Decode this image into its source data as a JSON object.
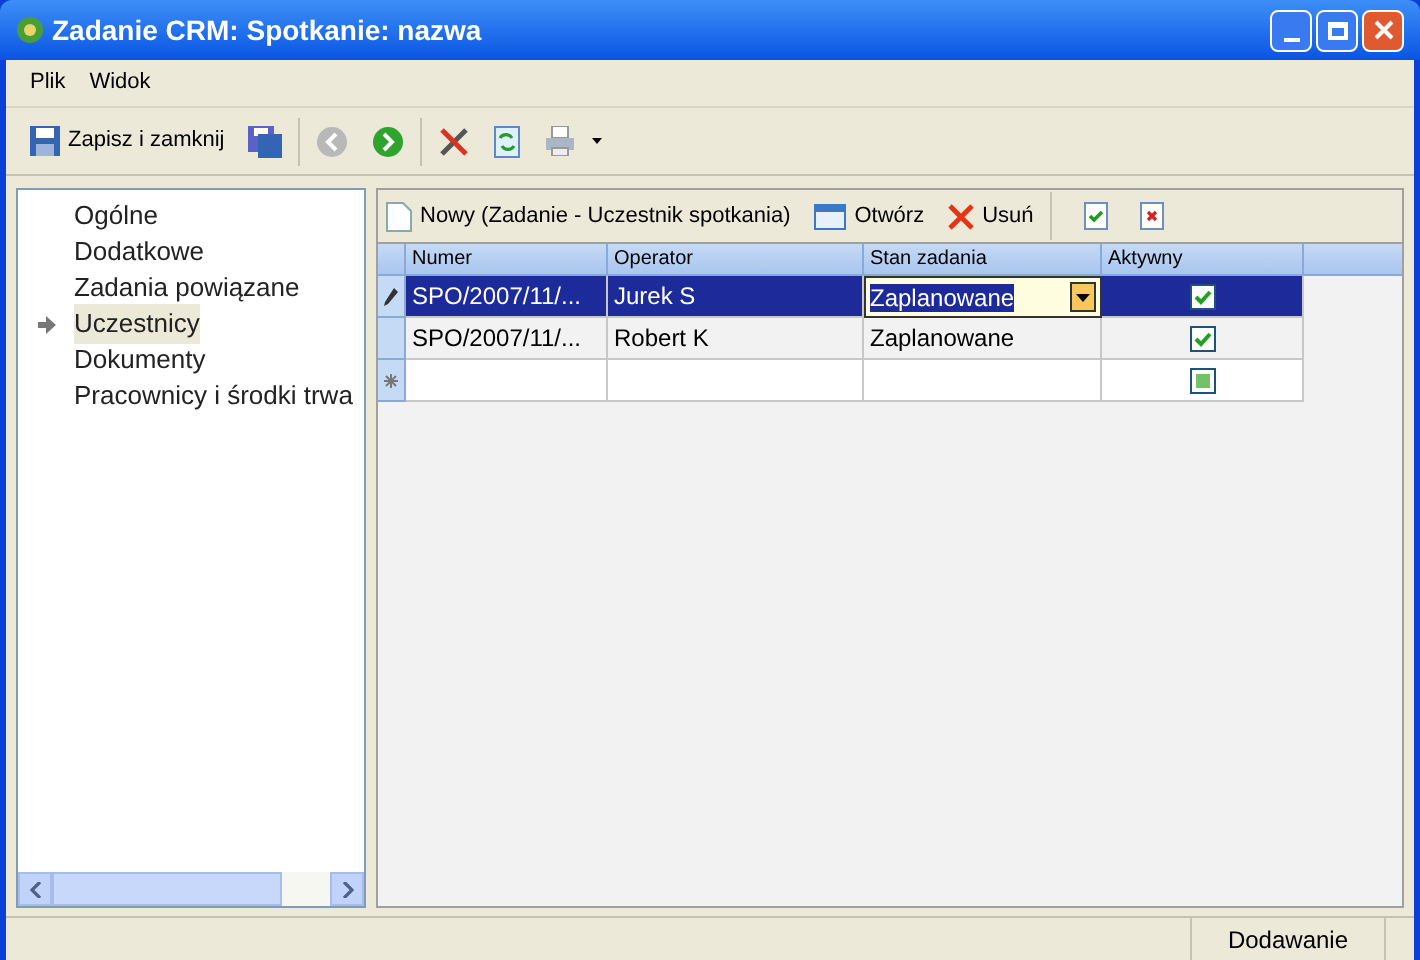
{
  "window": {
    "title": "Zadanie CRM: Spotkanie: nazwa"
  },
  "menu": [
    "Plik",
    "Widok"
  ],
  "toolbar": {
    "save_close": "Zapisz i zamknij"
  },
  "sidebar": {
    "items": [
      {
        "label": "Ogólne",
        "selected": false
      },
      {
        "label": "Dodatkowe",
        "selected": false
      },
      {
        "label": "Zadania powiązane",
        "selected": false
      },
      {
        "label": "Uczestnicy",
        "selected": true
      },
      {
        "label": "Dokumenty",
        "selected": false
      },
      {
        "label": "Pracownicy i środki trwa",
        "selected": false
      }
    ]
  },
  "grid_toolbar": {
    "new": "Nowy (Zadanie - Uczestnik spotkania)",
    "open": "Otwórz",
    "delete": "Usuń"
  },
  "table": {
    "columns": [
      "Numer",
      "Operator",
      "Stan zadania",
      "Aktywny"
    ],
    "rows": [
      {
        "kind": "editing",
        "selected": true,
        "numer": "SPO/2007/11/...",
        "operator": "Jurek S",
        "stan": "Zaplanowane",
        "checked": true,
        "indeterminate": false
      },
      {
        "kind": "normal",
        "selected": false,
        "numer": "SPO/2007/11/...",
        "operator": "Robert K",
        "stan": "Zaplanowane",
        "checked": true,
        "indeterminate": false
      },
      {
        "kind": "new",
        "selected": false,
        "checked": false,
        "indeterminate": true
      }
    ]
  },
  "status_bar": {
    "mode": "Dodawanie"
  }
}
